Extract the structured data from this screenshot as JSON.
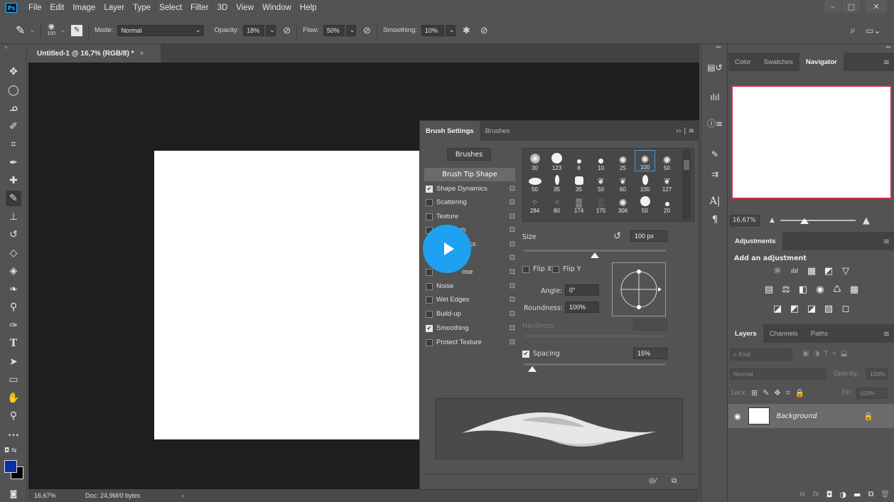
{
  "app": {
    "logo": "Ps",
    "menu": [
      "File",
      "Edit",
      "Image",
      "Layer",
      "Type",
      "Select",
      "Filter",
      "3D",
      "View",
      "Window",
      "Help"
    ],
    "window_controls": [
      "–",
      "□",
      "✕"
    ]
  },
  "options_bar": {
    "brush_size": "100",
    "mode_label": "Mode:",
    "mode_value": "Normal",
    "opacity_label": "Opacity:",
    "opacity_value": "18%",
    "flow_label": "Flow:",
    "flow_value": "50%",
    "smoothing_label": "Smoothing:",
    "smoothing_value": "10%"
  },
  "document": {
    "tab_title": "Untitled-1 @ 16,7% (RGB/8) *",
    "tab_close": "×",
    "zoom": "16,67%",
    "doc_info": "Doc: 24,9M/0 bytes",
    "status_arrow": "›"
  },
  "toolbar": {
    "collapse": "»",
    "ellipsis": "•••",
    "foreground_color": "#0a2fa8",
    "background_color": "#000000"
  },
  "brush_panel": {
    "tabs": [
      "Brush Settings",
      "Brushes"
    ],
    "menu_glyph": "›› | ≡",
    "brushes_button": "Brushes",
    "brush_tip_shape": "Brush Tip Shape",
    "options": [
      {
        "label": "Shape Dynamics",
        "checked": true
      },
      {
        "label": "Scattering",
        "checked": false
      },
      {
        "label": "Texture",
        "checked": false
      },
      {
        "label": "ush",
        "checked": false
      },
      {
        "label": "mics",
        "checked": false
      },
      {
        "label": "",
        "checked": false
      },
      {
        "label": "ose",
        "checked": false
      },
      {
        "label": "Noise",
        "checked": false
      },
      {
        "label": "Wet Edges",
        "checked": false
      },
      {
        "label": "Build-up",
        "checked": false
      },
      {
        "label": "Smoothing",
        "checked": true
      },
      {
        "label": "Protect Texture",
        "checked": false
      }
    ],
    "tip_sizes": [
      "30",
      "123",
      "8",
      "10",
      "25",
      "100",
      "50",
      "50",
      "35",
      "35",
      "50",
      "60",
      "100",
      "127",
      "284",
      "80",
      "174",
      "175",
      "306",
      "50",
      "20"
    ],
    "size_label": "Size",
    "size_value": "100 px",
    "flip_x": "Flip X",
    "flip_y": "Flip Y",
    "angle_label": "Angle:",
    "angle_value": "0°",
    "roundness_label": "Roundness:",
    "roundness_value": "100%",
    "hardness_label": "Hardness",
    "spacing_label": "Spacing",
    "spacing_value": "15%",
    "spacing_checked": true
  },
  "navigator": {
    "tabs": [
      "Color",
      "Swatches",
      "Navigator"
    ],
    "zoom": "16,67%",
    "frame_color": "#c8324a"
  },
  "adjustments": {
    "title": "Adjustments",
    "subtitle": "Add an adjustment",
    "icons_row1": [
      "☼",
      "ılıl",
      "▦",
      "◩",
      "▽"
    ],
    "icons_row2": [
      "▤",
      "⚖",
      "◧",
      "◉",
      "♺",
      "▦"
    ],
    "icons_row3": [
      "◪",
      "◩",
      "◪",
      "▨",
      "◻"
    ]
  },
  "layers": {
    "tabs": [
      "Layers",
      "Channels",
      "Paths"
    ],
    "kind_placeholder": "Kind",
    "blend_mode": "Normal",
    "opacity_label": "Opacity:",
    "opacity_value": "100%",
    "lock_label": "Lock:",
    "fill_label": "Fill:",
    "fill_value": "100%",
    "layer_name": "Background",
    "footer_icons": [
      "⊖",
      "fx",
      "◘",
      "◑",
      "▬",
      "⧉",
      "🗑"
    ]
  }
}
